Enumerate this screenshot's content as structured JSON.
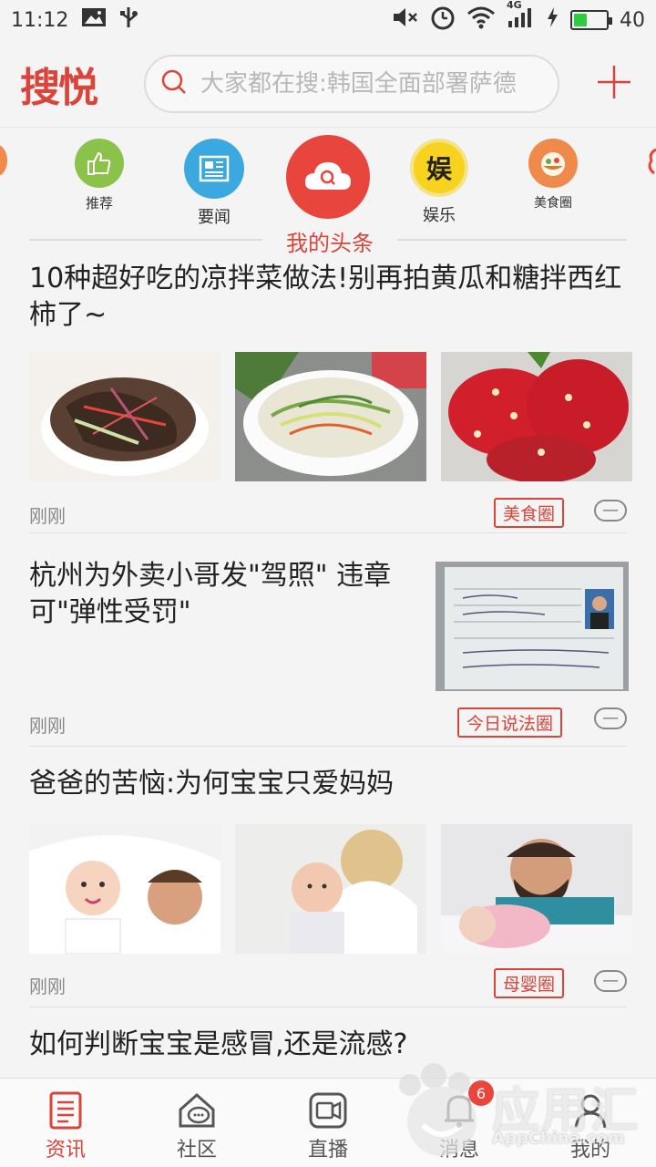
{
  "status_bar": {
    "time": "11:12",
    "network": "4G",
    "battery": "40",
    "battery_level": 0.4
  },
  "header": {
    "logo": "搜悦",
    "search_placeholder": "大家都在搜:韩国全面部署萨德"
  },
  "categories": [
    {
      "label": "推荐",
      "color": "#8bc34a"
    },
    {
      "label": "要闻",
      "color": "#3ba9e0"
    },
    {
      "label": "",
      "color": "#e8453c"
    },
    {
      "label": "娱乐",
      "badge_text": "娱",
      "color": "#f7d21e"
    },
    {
      "label": "美食圈",
      "color": "#f08a4b"
    }
  ],
  "section_title": "我的头条",
  "feed": [
    {
      "title": "10种超好吃的凉拌菜做法!别再拍黄瓜和糖拌西红柿了~",
      "time": "刚刚",
      "tag": "美食圈",
      "dismiss": "—"
    },
    {
      "title": "杭州为外卖小哥发\"驾照\" 违章可\"弹性受罚\"",
      "time": "刚刚",
      "tag": "今日说法圈",
      "dismiss": "—"
    },
    {
      "title": "爸爸的苦恼:为何宝宝只爱妈妈",
      "time": "刚刚",
      "tag": "母婴圈",
      "dismiss": "—"
    },
    {
      "title": "如何判断宝宝是感冒,还是流感?"
    }
  ],
  "bottom_nav": [
    {
      "label": "资讯",
      "active": true
    },
    {
      "label": "社区"
    },
    {
      "label": "直播"
    },
    {
      "label": "消息",
      "badge": "6"
    },
    {
      "label": "我的"
    }
  ],
  "watermark": {
    "main": "应用汇",
    "sub": "AppChina.com"
  },
  "colors": {
    "accent": "#d9443b",
    "background": "#f4f4f4"
  }
}
